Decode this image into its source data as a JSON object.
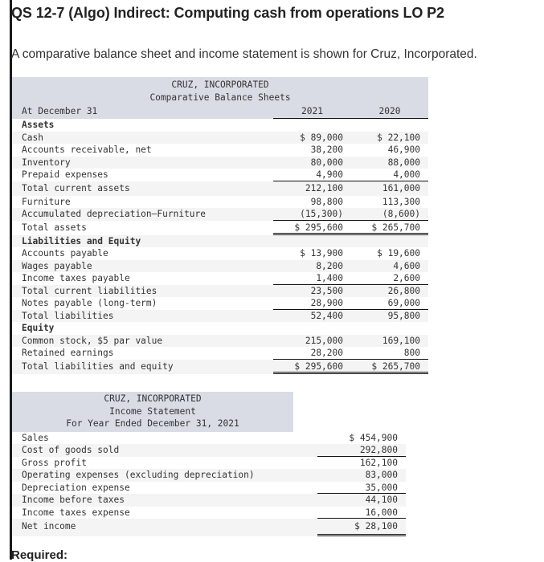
{
  "header": {
    "title": "QS 12-7 (Algo) Indirect: Computing cash from operations LO P2",
    "intro": "A comparative balance sheet and income statement is shown for Cruz, Incorporated."
  },
  "balance_sheet": {
    "company": "CRUZ, INCORPORATED",
    "statement": "Comparative Balance Sheets",
    "date_label": "At December 31",
    "col1": "2021",
    "col2": "2020",
    "rows": [
      {
        "label": "Assets",
        "v1": "",
        "v2": ""
      },
      {
        "label": "Cash",
        "v1": "$ 89,000",
        "v2": "$ 22,100"
      },
      {
        "label": "Accounts receivable, net",
        "v1": "38,200",
        "v2": "46,900"
      },
      {
        "label": "Inventory",
        "v1": "80,000",
        "v2": "88,000"
      },
      {
        "label": "Prepaid expenses",
        "v1": "4,900",
        "v2": "4,000"
      },
      {
        "label": "Total current assets",
        "v1": "212,100",
        "v2": "161,000"
      },
      {
        "label": "Furniture",
        "v1": "98,800",
        "v2": "113,300"
      },
      {
        "label": "Accumulated depreciation—Furniture",
        "v1": "(15,300)",
        "v2": "(8,600)"
      },
      {
        "label": "Total assets",
        "v1": "$ 295,600",
        "v2": "$ 265,700"
      },
      {
        "label": "Liabilities and Equity",
        "v1": "",
        "v2": ""
      },
      {
        "label": "Accounts payable",
        "v1": "$ 13,900",
        "v2": "$ 19,600"
      },
      {
        "label": "Wages payable",
        "v1": "8,200",
        "v2": "4,600"
      },
      {
        "label": "Income taxes payable",
        "v1": "1,400",
        "v2": "2,600"
      },
      {
        "label": "Total current liabilities",
        "v1": "23,500",
        "v2": "26,800"
      },
      {
        "label": "Notes payable (long-term)",
        "v1": "28,900",
        "v2": "69,000"
      },
      {
        "label": "Total liabilities",
        "v1": "52,400",
        "v2": "95,800"
      },
      {
        "label": "Equity",
        "v1": "",
        "v2": ""
      },
      {
        "label": "Common stock, $5 par value",
        "v1": "215,000",
        "v2": "169,100"
      },
      {
        "label": "Retained earnings",
        "v1": "28,200",
        "v2": "800"
      },
      {
        "label": "Total liabilities and equity",
        "v1": "$ 295,600",
        "v2": "$ 265,700"
      }
    ]
  },
  "income_statement": {
    "company": "CRUZ, INCORPORATED",
    "statement": "Income Statement",
    "period": "For Year Ended December 31, 2021",
    "rows": [
      {
        "label": "Sales",
        "value": "$ 454,900"
      },
      {
        "label": "Cost of goods sold",
        "value": "292,800"
      },
      {
        "label": "Gross profit",
        "value": "162,100"
      },
      {
        "label": "Operating expenses (excluding depreciation)",
        "value": "83,000"
      },
      {
        "label": "Depreciation expense",
        "value": "35,000"
      },
      {
        "label": "Income before taxes",
        "value": "44,100"
      },
      {
        "label": "Income taxes expense",
        "value": "16,000"
      },
      {
        "label": "Net income",
        "value": "$ 28,100"
      }
    ]
  },
  "footer": {
    "required_label": "Required:"
  }
}
